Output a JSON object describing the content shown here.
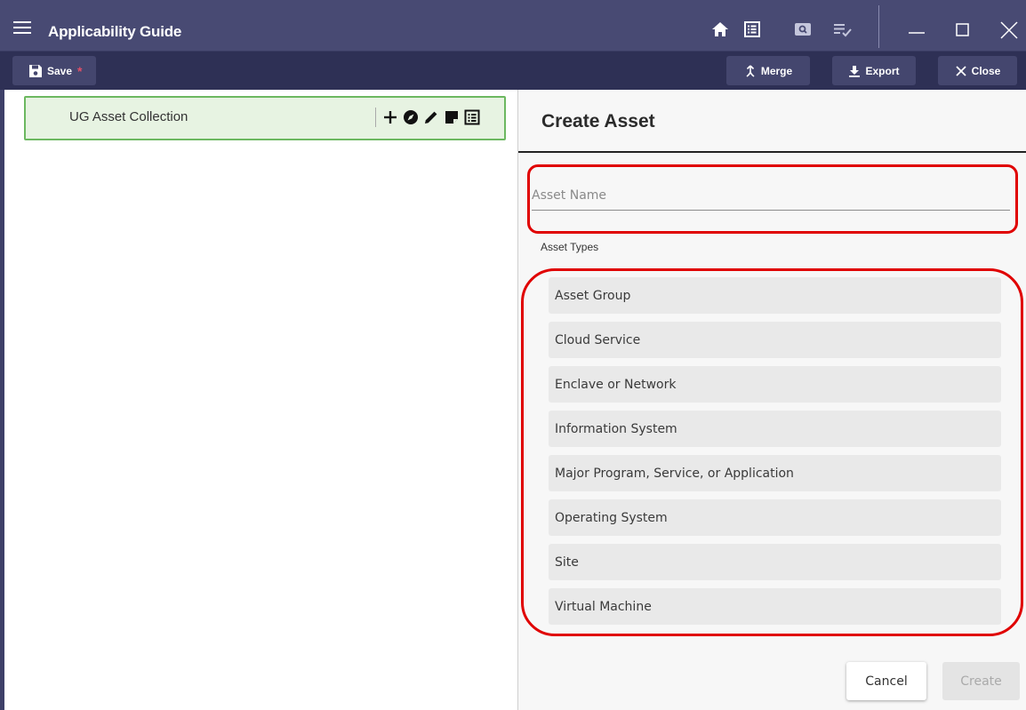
{
  "window": {
    "title": "Applicability Guide",
    "icons": [
      "home-icon",
      "list-icon",
      "search-panel-icon",
      "playlist-check-icon",
      "minimize-icon",
      "maximize-icon",
      "close-window-icon"
    ]
  },
  "toolbar": {
    "save_label": "Save",
    "save_dirty_marker": "*",
    "merge_label": "Merge",
    "export_label": "Export",
    "close_label": "Close"
  },
  "tree": {
    "node_label": "UG Asset Collection",
    "node_actions": [
      "add-icon",
      "compass-icon",
      "edit-icon",
      "note-icon",
      "details-icon"
    ]
  },
  "form": {
    "title": "Create Asset",
    "asset_name_placeholder": "Asset Name",
    "asset_name_value": "",
    "types_label": "Asset Types",
    "asset_types": [
      "Asset Group",
      "Cloud Service",
      "Enclave or Network",
      "Information System",
      "Major Program, Service, or Application",
      "Operating System",
      "Site",
      "Virtual Machine"
    ],
    "cancel_label": "Cancel",
    "create_label": "Create"
  },
  "colors": {
    "titlebar": "#484a73",
    "toolbar": "#2e3055",
    "node_bg": "#e7f3e2",
    "node_border": "#6cb860",
    "highlight": "#e00000"
  }
}
